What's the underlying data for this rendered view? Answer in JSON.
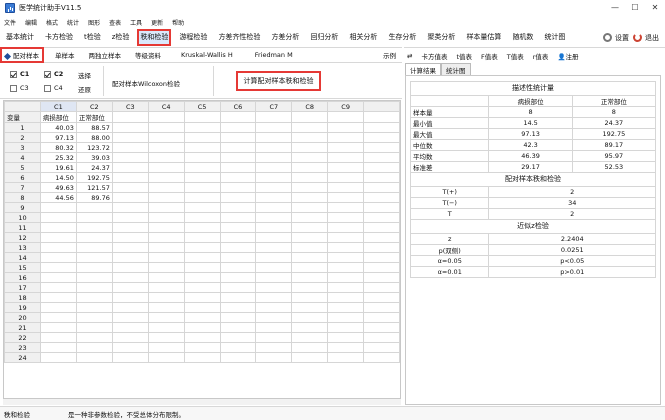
{
  "title": "医学统计助手V11.5",
  "window_controls": [
    "—",
    "☐",
    "✕"
  ],
  "menu": [
    "文件",
    "编辑",
    "格式",
    "统计",
    "图形",
    "查表",
    "工具",
    "更新",
    "帮助"
  ],
  "toolbar": {
    "items": [
      "基本统计",
      "卡方检验",
      "t检验",
      "z检验",
      "秩和检验",
      "游程检验",
      "方差齐性检验",
      "方差分析",
      "回归分析",
      "相关分析",
      "生存分析",
      "聚类分析",
      "样本量估算",
      "随机数",
      "统计图"
    ],
    "active_index": 4,
    "settings_label": "设置",
    "exit_label": "退出"
  },
  "subtabs": {
    "items": [
      "配对样本",
      "单样本",
      "两独立样本",
      "等级资料",
      "Kruskal-Wallis H",
      "Friedman M"
    ],
    "active_index": 0,
    "example_label": "示例"
  },
  "options": {
    "c1": "C1",
    "c2": "C2",
    "c3": "C3",
    "c4": "C4",
    "c1_checked": true,
    "c2_checked": true,
    "c3_checked": false,
    "c4_checked": false,
    "select_label": "选择",
    "restore_label": "还原",
    "method_label": "配对样本Wilcoxon检验",
    "calc_button": "计算配对样本秩和检验"
  },
  "grid": {
    "col_headers": [
      "",
      "C1",
      "C2",
      "C3",
      "C4",
      "C5",
      "C6",
      "C7",
      "C8",
      "C9"
    ],
    "row_header_label": "变量",
    "var_names": [
      "正常部位",
      "病损部位"
    ],
    "row_labels": [
      "1",
      "2",
      "3",
      "4",
      "5",
      "6",
      "7",
      "8",
      "9",
      "10",
      "11",
      "12",
      "13",
      "14",
      "15",
      "16",
      "17",
      "18",
      "19",
      "20",
      "21",
      "22",
      "23",
      "24"
    ],
    "c1": [
      "40.03",
      "97.13",
      "80.32",
      "25.32",
      "19.61",
      "14.50",
      "49.63",
      "44.56",
      "",
      "",
      "",
      "",
      "",
      "",
      "",
      "",
      "",
      "",
      "",
      "",
      "",
      "",
      "",
      ""
    ],
    "c2": [
      "88.57",
      "88.00",
      "123.72",
      "39.03",
      "24.37",
      "192.75",
      "121.57",
      "89.76",
      "",
      "",
      "",
      "",
      "",
      "",
      "",
      "",
      "",
      "",
      "",
      "",
      "",
      "",
      "",
      ""
    ]
  },
  "right_tabs": {
    "items": [
      "卡方值表",
      "t值表",
      "F值表",
      "T值表",
      "r值表",
      "注册"
    ]
  },
  "result_tabs": [
    "计算结果",
    "统计图"
  ],
  "result": {
    "desc_title": "描述性统计量",
    "desc_headers": [
      "",
      "病损部位",
      "正常部位"
    ],
    "desc_rows": [
      [
        "样本量",
        "8",
        "8"
      ],
      [
        "最小值",
        "14.5",
        "24.37"
      ],
      [
        "最大值",
        "97.13",
        "192.75"
      ],
      [
        "中位数",
        "42.3",
        "89.17"
      ],
      [
        "平均数",
        "46.39",
        "95.97"
      ],
      [
        "标准差",
        "29.17",
        "52.53"
      ]
    ],
    "rank_title": "配对样本秩和检验",
    "rank_rows": [
      [
        "T(+)",
        "2"
      ],
      [
        "T(−)",
        "34"
      ],
      [
        "T",
        "2"
      ]
    ],
    "approx_title": "近似z检验",
    "approx_rows": [
      [
        "z",
        "2.2404"
      ],
      [
        "p(双侧)",
        "0.0251"
      ],
      [
        "α=0.05",
        "p<0.05"
      ],
      [
        "α=0.01",
        "p>0.01"
      ]
    ]
  },
  "status": {
    "name": "秩和检验",
    "desc": "是一种非参数检验，不受总体分布限制。"
  }
}
